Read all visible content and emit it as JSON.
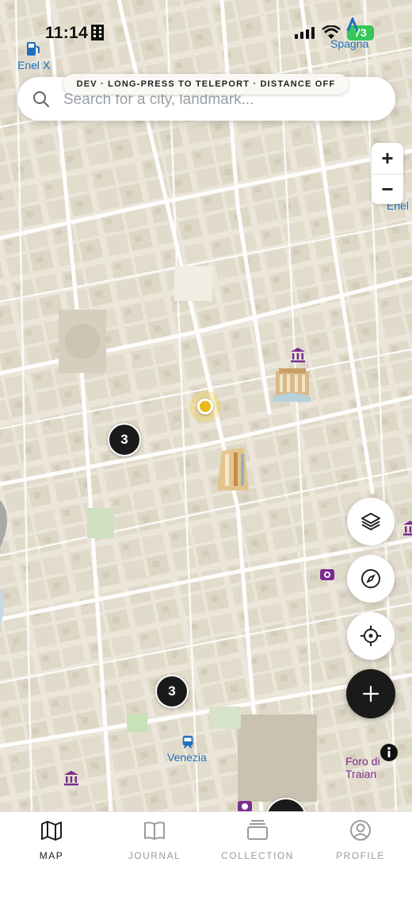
{
  "status_bar": {
    "time": "11:14",
    "battery": "73"
  },
  "map_labels": {
    "enel_left": "Enel X",
    "enel_right": "Enel",
    "spagna": "Spagna",
    "venezia": "Venezia",
    "foro": "Foro di Traian"
  },
  "dev_banner": "DEV · LONG-PRESS TO TELEPORT · DISTANCE OFF",
  "search": {
    "placeholder": "Search for a city, landmark..."
  },
  "clusters": [
    {
      "count": "3"
    },
    {
      "count": "3"
    }
  ],
  "icons": {
    "layers": "layers-icon",
    "compass": "compass-icon",
    "locate": "crosshair-icon",
    "add": "plus-icon",
    "museum": "museum-icon",
    "camera": "camera-icon",
    "tram": "tram-icon",
    "info": "info-icon"
  },
  "colors": {
    "map_background": "#ebe6d9",
    "poi_purple": "#7b2d8e",
    "poi_blue": "#1f6fbd",
    "user_location": "#e9b91a",
    "cluster": "#1a1a1a"
  },
  "tabs": [
    {
      "label": "MAP",
      "active": true
    },
    {
      "label": "JOURNAL",
      "active": false
    },
    {
      "label": "COLLECTION",
      "active": false
    },
    {
      "label": "PROFILE",
      "active": false
    }
  ]
}
